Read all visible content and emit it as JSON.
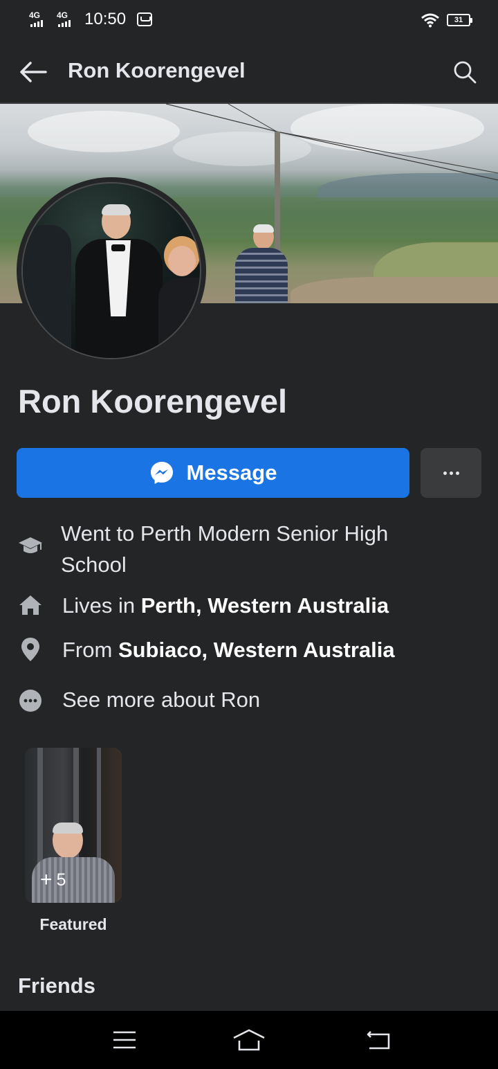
{
  "status_bar": {
    "network_1": "4G",
    "network_2": "4G",
    "time": "10:50",
    "battery": "31"
  },
  "header": {
    "title": "Ron Koorengevel"
  },
  "profile": {
    "name": "Ron Koorengevel"
  },
  "actions": {
    "message_label": "Message",
    "accent_color": "#1b74e4"
  },
  "about": {
    "education": "Went to Perth Modern Senior High School",
    "lives_prefix": "Lives in ",
    "lives_place": "Perth, Western Australia",
    "from_prefix": "From ",
    "from_place": "Subiaco, Western Australia",
    "see_more": "See more about Ron"
  },
  "featured": {
    "count": "5",
    "label": "Featured"
  },
  "friends": {
    "heading": "Friends"
  },
  "icons": {
    "back": "arrow-left-icon",
    "search": "search-icon",
    "messenger": "messenger-icon",
    "more": "more-dots-icon",
    "education": "graduation-cap-icon",
    "home": "home-icon",
    "location": "location-pin-icon",
    "see_more": "ellipsis-circle-icon"
  }
}
